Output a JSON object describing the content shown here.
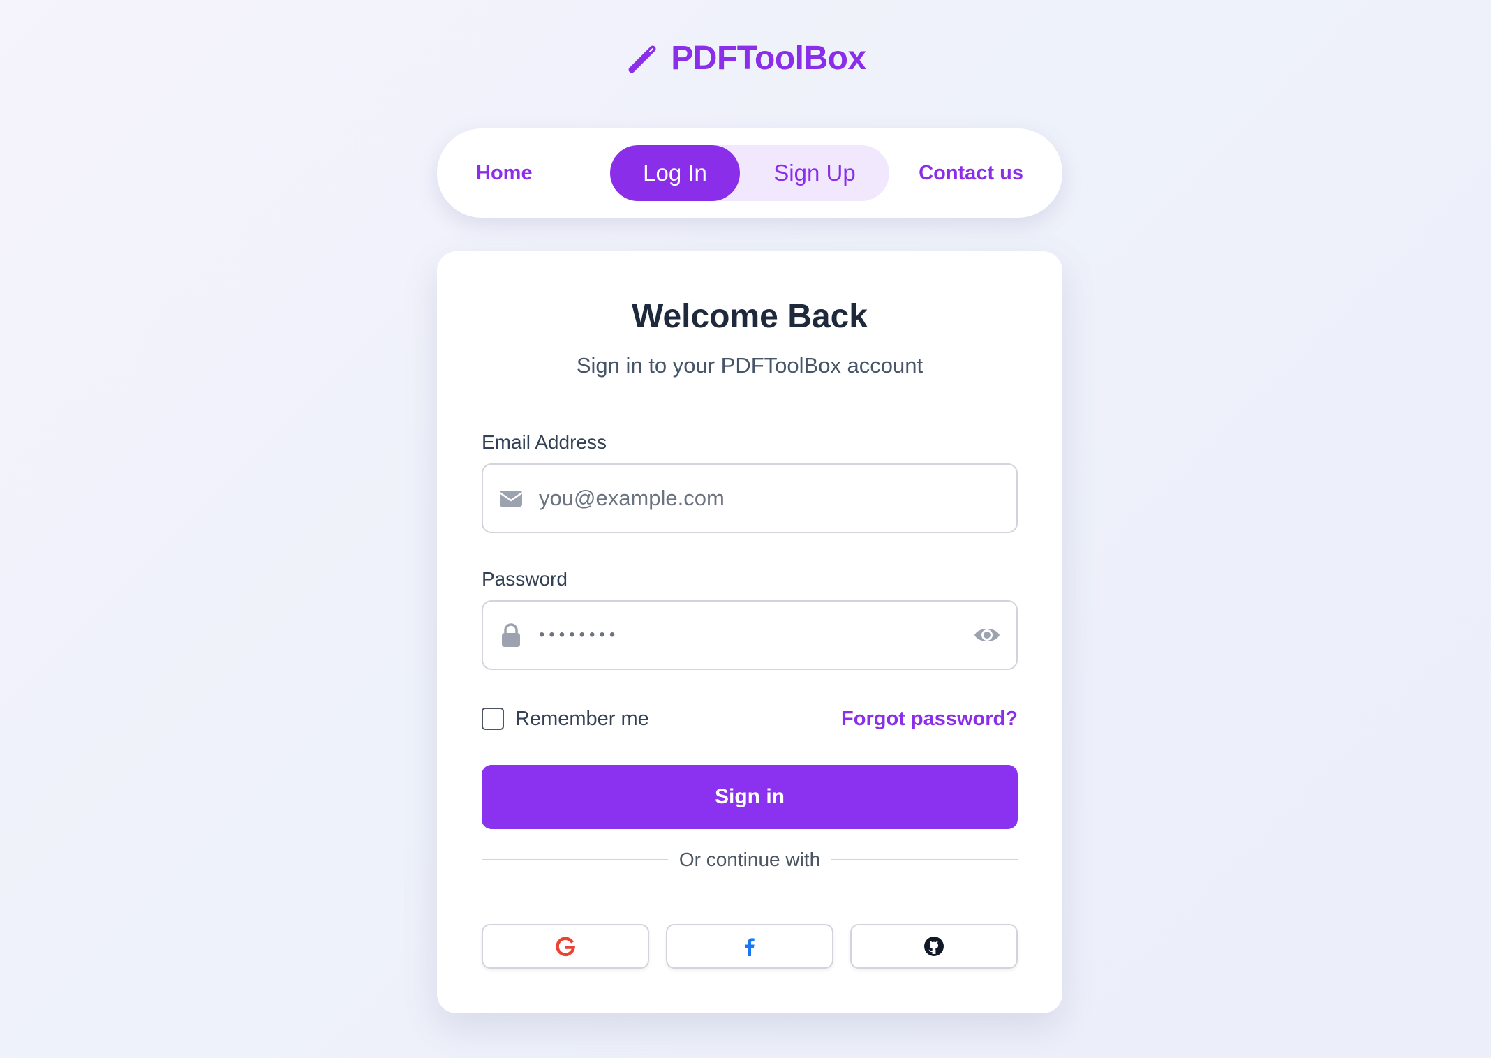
{
  "brand": {
    "name": "PDFToolBox",
    "icon": "pen-icon",
    "accent_color": "#8b2eea"
  },
  "nav": {
    "home": "Home",
    "login": "Log In",
    "signup": "Sign Up",
    "contact": "Contact us",
    "active_tab": "Log In"
  },
  "card": {
    "title": "Welcome Back",
    "subtitle": "Sign in to your PDFToolBox account"
  },
  "form": {
    "email": {
      "label": "Email Address",
      "placeholder": "you@example.com",
      "value": "",
      "icon": "envelope-icon"
    },
    "password": {
      "label": "Password",
      "value": "••••••••",
      "icon": "lock-icon",
      "toggle_icon": "eye-icon"
    },
    "remember_label": "Remember me",
    "remember_checked": false,
    "forgot_label": "Forgot password?",
    "submit_label": "Sign in",
    "submit_color": "#8b31f0"
  },
  "social": {
    "divider_text": "Or continue with",
    "providers": [
      {
        "name": "google",
        "icon": "google-icon",
        "color": "#ea4335"
      },
      {
        "name": "facebook",
        "icon": "facebook-icon",
        "color": "#1877f2"
      },
      {
        "name": "github",
        "icon": "github-icon",
        "color": "#111827"
      }
    ]
  }
}
